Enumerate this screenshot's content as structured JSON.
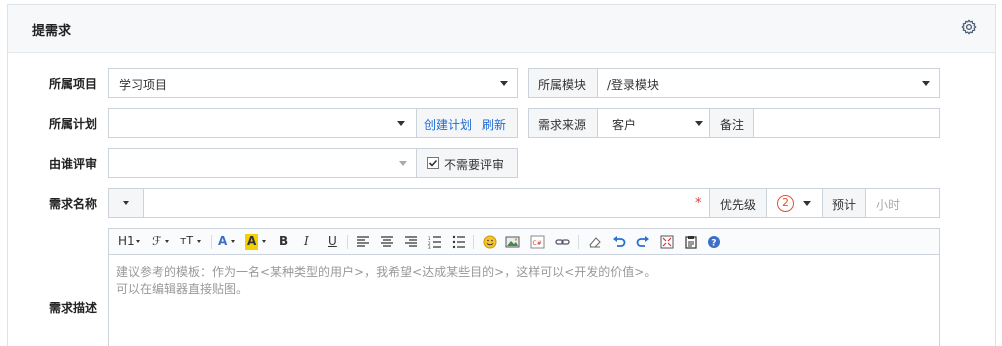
{
  "panel": {
    "title": "提需求"
  },
  "row1": {
    "project_label": "所属项目",
    "project_value": "学习项目",
    "module_label": "所属模块",
    "module_value": "/登录模块"
  },
  "row2": {
    "plan_label": "所属计划",
    "create_plan": "创建计划",
    "refresh": "刷新",
    "source_label": "需求来源",
    "source_value": "客户",
    "note_label": "备注"
  },
  "row3": {
    "reviewer_label": "由谁评审",
    "no_review_label": "不需要评审",
    "no_review_checked": true
  },
  "row4": {
    "name_label": "需求名称",
    "required_mark": "*",
    "priority_label": "优先级",
    "priority_value": "2",
    "estimate_label": "预计",
    "estimate_placeholder": "小时"
  },
  "editor": {
    "desc_label": "需求描述",
    "heading_btn": "H1",
    "font_btn": "ℱ",
    "size_btn": "тT",
    "placeholder_line1": "建议参考的模板：作为一名<某种类型的用户>，我希望<达成某些目的>，这样可以<开发的价值>。",
    "placeholder_line2": "可以在编辑器直接贴图。"
  },
  "colors": {
    "link": "#1f6bd6",
    "required": "#e23b3b",
    "priority": "#e8502e",
    "border": "#ccd2d9"
  }
}
